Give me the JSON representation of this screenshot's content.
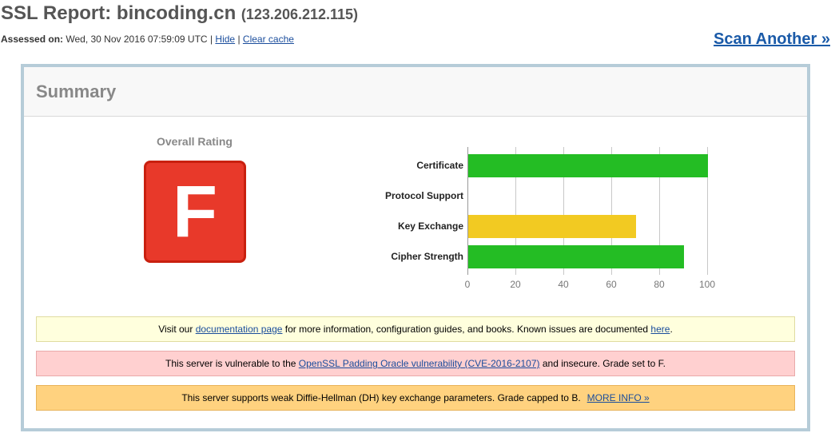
{
  "header": {
    "title_prefix": "SSL Report: ",
    "host": "bincoding.cn",
    "ip": "(123.206.212.115)",
    "assessed_label": "Assessed on:",
    "assessed_value": "Wed, 30 Nov 2016 07:59:09 UTC",
    "separator": "|",
    "hide_link": "Hide",
    "clear_cache_link": "Clear cache",
    "scan_another": "Scan Another »"
  },
  "summary": {
    "title": "Summary",
    "overall_label": "Overall Rating",
    "grade": "F",
    "grade_color": "#e8392a"
  },
  "chart_data": {
    "type": "bar",
    "orientation": "horizontal",
    "categories": [
      "Certificate",
      "Protocol Support",
      "Key Exchange",
      "Cipher Strength"
    ],
    "values": [
      100,
      0,
      70,
      90
    ],
    "colors": [
      "#22b422",
      "#22b422",
      "#e6c020",
      "#22b422"
    ],
    "xlim": [
      0,
      100
    ],
    "ticks": [
      "0",
      "20",
      "40",
      "60",
      "80",
      "100"
    ],
    "grid": true
  },
  "notices": {
    "doc": {
      "pre": "Visit our ",
      "link1": "documentation page",
      "mid": " for more information, configuration guides, and books. Known issues are documented ",
      "link2": "here",
      "post": "."
    },
    "vuln": {
      "pre": "This server is vulnerable to the ",
      "link": "OpenSSL Padding Oracle vulnerability (CVE-2016-2107)",
      "post": " and insecure. Grade set to F."
    },
    "dh": {
      "text": "This server supports weak Diffie-Hellman (DH) key exchange parameters. Grade capped to B.",
      "link": "MORE INFO »"
    }
  }
}
